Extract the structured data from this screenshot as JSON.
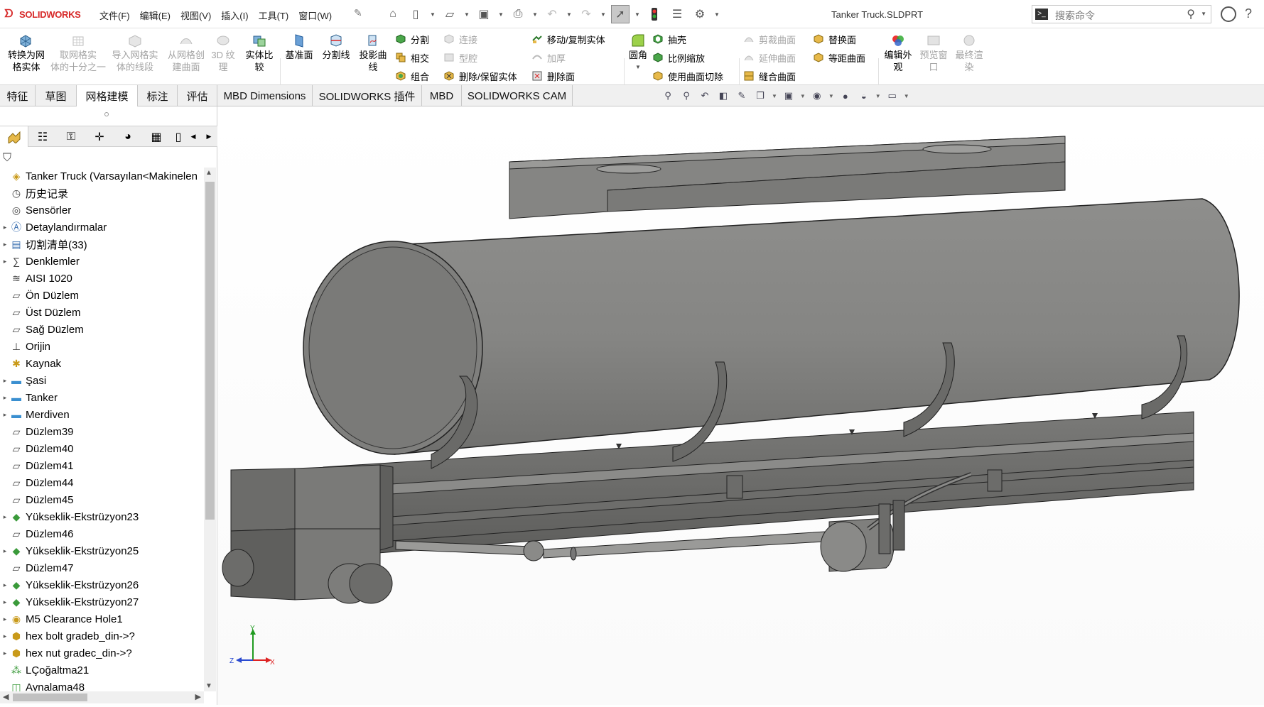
{
  "app": {
    "logo": "SOLIDWORKS",
    "doc_title": "Tanker Truck.SLDPRT"
  },
  "menu": [
    "文件(F)",
    "编辑(E)",
    "视图(V)",
    "插入(I)",
    "工具(T)",
    "窗口(W)"
  ],
  "search": {
    "placeholder": "搜索命令"
  },
  "ribbon": {
    "convert": "转换为网\n格实体",
    "no_mesh": "取网格实\n体的十分之一",
    "import_mesh": "导入网格实\n体的线段",
    "from_mesh": "从网格创\n建曲面",
    "texture3d": "3D 纹\n理",
    "compare": "实体比\n较",
    "ref_plane": "基准面",
    "split_line": "分割线",
    "proj_curve": "投影曲\n线",
    "split": "分割",
    "intersect": "相交",
    "combine": "组合",
    "connect": "连接",
    "cavity": "型腔",
    "delete_keep": "删除/保留实体",
    "move_copy": "移动/复制实体",
    "thicken": "加厚",
    "delete_face": "删除面",
    "fillet": "圆角",
    "shell": "抽壳",
    "scale": "比例缩放",
    "surface_cut": "使用曲面切除",
    "trim_surface": "剪裁曲面",
    "extend_surface": "延伸曲面",
    "knit_surface": "缝合曲面",
    "replace_face": "替换面",
    "offset_surface": "等距曲面",
    "edit_appearance": "编辑外\n观",
    "preview_window": "预览窗\n口",
    "final_render": "最终渲\n染"
  },
  "tabs": [
    "特征",
    "草图",
    "网格建模",
    "标注",
    "评估",
    "MBD Dimensions",
    "SOLIDWORKS 插件",
    "MBD",
    "SOLIDWORKS CAM"
  ],
  "active_tab": "网格建模",
  "tree": [
    {
      "label": "Tanker Truck (Varsayılan<Makinelen",
      "icon": "part-icon",
      "expand": false
    },
    {
      "label": "历史记录",
      "icon": "history-icon",
      "expand": false
    },
    {
      "label": "Sensörler",
      "icon": "sensor-icon",
      "expand": false
    },
    {
      "label": "Detaylandırmalar",
      "icon": "annotation-icon",
      "expand": true
    },
    {
      "label": "切割清单(33)",
      "icon": "cutlist-icon",
      "expand": true
    },
    {
      "label": "Denklemler",
      "icon": "equation-icon",
      "expand": true
    },
    {
      "label": "AISI 1020",
      "icon": "material-icon",
      "expand": false
    },
    {
      "label": "Ön Düzlem",
      "icon": "plane-icon",
      "expand": false
    },
    {
      "label": "Üst Düzlem",
      "icon": "plane-icon",
      "expand": false
    },
    {
      "label": "Sağ Düzlem",
      "icon": "plane-icon",
      "expand": false
    },
    {
      "label": "Orijin",
      "icon": "origin-icon",
      "expand": false
    },
    {
      "label": "Kaynak",
      "icon": "weld-icon",
      "expand": false
    },
    {
      "label": "Şasi",
      "icon": "folder-icon",
      "expand": true
    },
    {
      "label": "Tanker",
      "icon": "folder-icon",
      "expand": true
    },
    {
      "label": "Merdiven",
      "icon": "folder-icon",
      "expand": true
    },
    {
      "label": "Düzlem39",
      "icon": "plane-icon",
      "expand": false
    },
    {
      "label": "Düzlem40",
      "icon": "plane-icon",
      "expand": false
    },
    {
      "label": "Düzlem41",
      "icon": "plane-icon",
      "expand": false
    },
    {
      "label": "Düzlem44",
      "icon": "plane-icon",
      "expand": false
    },
    {
      "label": "Düzlem45",
      "icon": "plane-icon",
      "expand": false
    },
    {
      "label": "Yükseklik-Ekstrüzyon23",
      "icon": "extrude-icon",
      "expand": true
    },
    {
      "label": "Düzlem46",
      "icon": "plane-icon",
      "expand": false
    },
    {
      "label": "Yükseklik-Ekstrüzyon25",
      "icon": "extrude-icon",
      "expand": true
    },
    {
      "label": "Düzlem47",
      "icon": "plane-icon",
      "expand": false
    },
    {
      "label": "Yükseklik-Ekstrüzyon26",
      "icon": "extrude-icon",
      "expand": true
    },
    {
      "label": "Yükseklik-Ekstrüzyon27",
      "icon": "extrude-icon",
      "expand": true
    },
    {
      "label": "M5 Clearance Hole1",
      "icon": "hole-icon",
      "expand": true
    },
    {
      "label": "hex bolt gradeb_din->?",
      "icon": "library-icon",
      "expand": true
    },
    {
      "label": "hex nut gradec_din->?",
      "icon": "library-icon",
      "expand": true
    },
    {
      "label": "LÇoğaltma21",
      "icon": "pattern-icon",
      "expand": false
    },
    {
      "label": "Aynalama48",
      "icon": "mirror-icon",
      "expand": false
    }
  ],
  "triad": {
    "x": "X",
    "y": "Y",
    "z": "Z"
  },
  "colors": {
    "brand": "#d72a2a",
    "model": "#8a8a88",
    "model_dark": "#6d6d6b",
    "edge": "#2a2a2a"
  }
}
